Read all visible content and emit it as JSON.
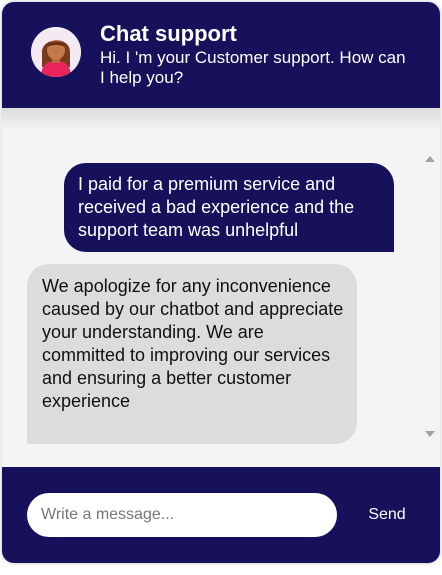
{
  "header": {
    "title": "Chat support",
    "subtitle": "Hi. I 'm your Customer support. How can I help you?",
    "avatar_icon": "woman-avatar-icon"
  },
  "messages": [
    {
      "sender": "user",
      "text": "I paid for a premium service and received a bad experience and the support team was unhelpful"
    },
    {
      "sender": "bot",
      "text": "We apologize for any inconvenience caused by our chatbot and appreciate your understanding. We are committed to improving our services and ensuring a better customer experience"
    }
  ],
  "composer": {
    "placeholder": "Write a message...",
    "value": "",
    "send_label": "Send"
  },
  "colors": {
    "brand": "#16115a",
    "bot_bubble": "#dcdcdc",
    "background": "#f4f4f4"
  }
}
